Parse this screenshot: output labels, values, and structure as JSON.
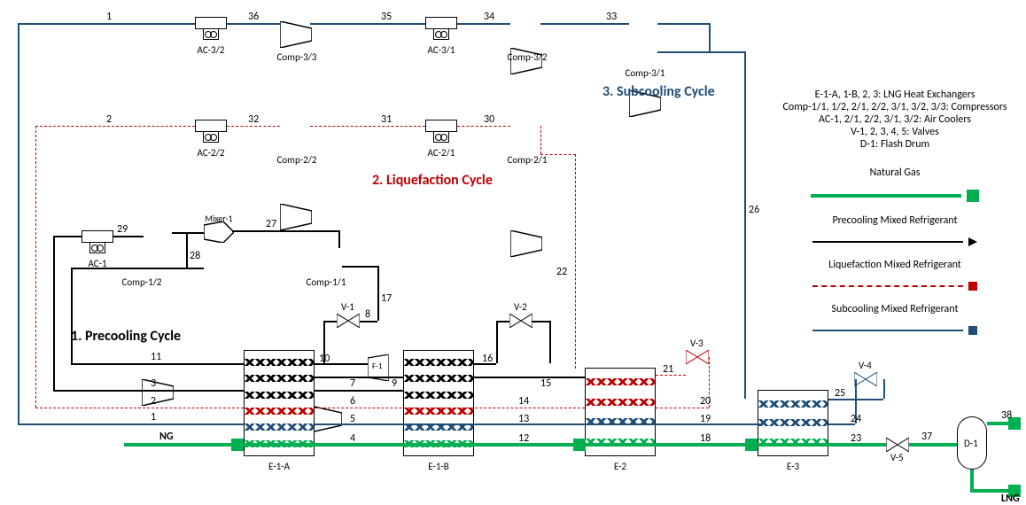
{
  "sections": {
    "precooling": "1. Precooling Cycle",
    "liquefaction": "2. Liquefaction Cycle",
    "subcooling": "3. Subcooling Cycle"
  },
  "glossary": [
    "E-1-A, 1-B, 2, 3: LNG Heat Exchangers",
    "Comp-1/1, 1/2, 2/1, 2/2, 3/1, 3/2, 3/3: Compressors",
    "AC-1, 2/1, 2/2, 3/1, 3/2: Air Coolers",
    "V-1, 2, 3, 4, 5: Valves",
    "D-1: Flash Drum"
  ],
  "legend": {
    "ng": "Natural Gas",
    "pre": "Precooling Mixed Refrigerant",
    "liq": "Liquefaction Mixed Refrigerant",
    "sub": "Subcooling Mixed Refrigerant"
  },
  "equipment": {
    "ac32": "AC-3/2",
    "ac31": "AC-3/1",
    "ac22": "AC-2/2",
    "ac21": "AC-2/1",
    "ac1": "AC-1",
    "c33": "Comp-3/3",
    "c32": "Comp-3/2",
    "c31": "Comp-3/1",
    "c22": "Comp-2/2",
    "c21": "Comp-2/1",
    "c12": "Comp-1/2",
    "c11": "Comp-1/1",
    "mix1": "Mixer-1",
    "v1": "V-1",
    "v2": "V-2",
    "v3": "V-3",
    "v4": "V-4",
    "v5": "V-5",
    "e1a": "E-1-A",
    "e1b": "E-1-B",
    "e2": "E-2",
    "e3": "E-3",
    "d1": "D-1",
    "f1": "F-1"
  },
  "streams": {
    "ng": "NG",
    "lng": "LNG",
    "s1": "1",
    "s2": "2",
    "s3": "3",
    "s4": "4",
    "s5": "5",
    "s6": "6",
    "s7": "7",
    "s8": "8",
    "s9": "9",
    "s10": "10",
    "s11": "11",
    "s12": "12",
    "s13": "13",
    "s14": "14",
    "s15": "15",
    "s16": "16",
    "s17": "17",
    "s18": "18",
    "s19": "19",
    "s20": "20",
    "s21": "21",
    "s22": "22",
    "s23": "23",
    "s24": "24",
    "s25": "25",
    "s26": "26",
    "s27": "27",
    "s28": "28",
    "s29": "29",
    "s30": "30",
    "s31": "31",
    "s32": "32",
    "s33": "33",
    "s34": "34",
    "s35": "35",
    "s36": "36",
    "s37": "37",
    "s38": "38"
  },
  "colors": {
    "precool": "#000000",
    "liquefy": "#c00000",
    "subcool": "#1f4e79",
    "ng": "#00b050"
  }
}
